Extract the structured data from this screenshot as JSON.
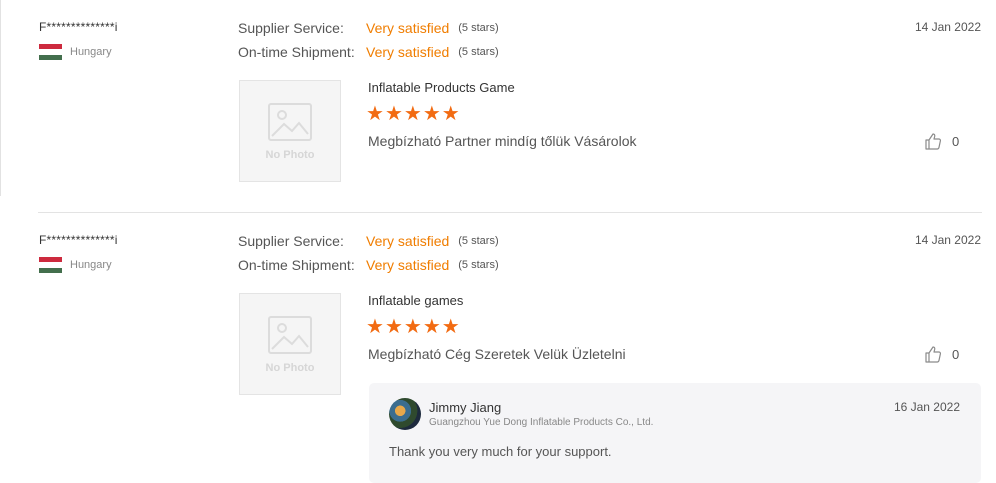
{
  "reviews": [
    {
      "buyer": "F**************i",
      "country": "Hungary",
      "supplier_label": "Supplier Service:",
      "supplier_value": "Very satisfied",
      "supplier_stars": "(5 stars)",
      "shipment_label": "On-time Shipment:",
      "shipment_value": "Very satisfied",
      "shipment_stars": "(5 stars)",
      "date": "14 Jan 2022",
      "no_photo": "No Photo",
      "product": "Inflatable Products Game",
      "rating": 5,
      "comment": "Megbízható Partner mindíg tőlük Vásárolok",
      "likes": "0"
    },
    {
      "buyer": "F**************i",
      "country": "Hungary",
      "supplier_label": "Supplier Service:",
      "supplier_value": "Very satisfied",
      "supplier_stars": "(5 stars)",
      "shipment_label": "On-time Shipment:",
      "shipment_value": "Very satisfied",
      "shipment_stars": "(5 stars)",
      "date": "14 Jan 2022",
      "no_photo": "No Photo",
      "product": "Inflatable games",
      "rating": 5,
      "comment": "Megbízható Cég Szeretek Velük Üzletelni",
      "likes": "0",
      "reply": {
        "name": "Jimmy Jiang",
        "company": "Guangzhou Yue Dong Inflatable Products Co., Ltd.",
        "date": "16 Jan 2022",
        "text": "Thank you very much for your support."
      }
    }
  ],
  "icons": {
    "flag": "hungary-flag-icon",
    "photo": "image-placeholder-icon",
    "like": "thumbs-up-icon",
    "star": "star-icon"
  },
  "colors": {
    "accent": "#f07d00",
    "star": "#f26b12",
    "flag_red": "#cd2a3e",
    "flag_white": "#ffffff",
    "flag_green": "#436f4d"
  }
}
